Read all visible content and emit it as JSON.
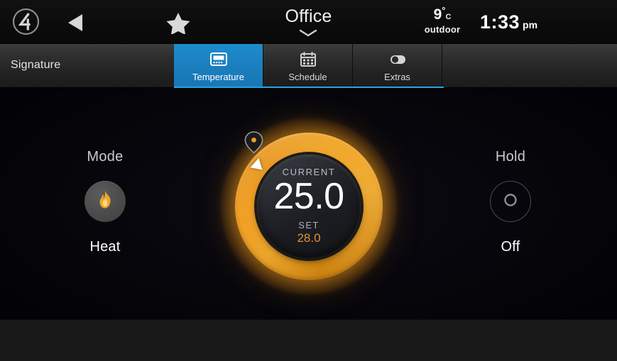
{
  "header": {
    "logo_icon": "control4-logo-icon",
    "back_icon": "back-arrow-icon",
    "favorites_icon": "star-icon",
    "room_name": "Office",
    "room_chevron_icon": "chevron-down-icon",
    "weather": {
      "temperature": "9",
      "degree_symbol": "°",
      "unit": "C",
      "label": "outdoor"
    },
    "clock": {
      "time": "1:33",
      "meridiem": "pm"
    }
  },
  "tabbar": {
    "signature_label": "Signature",
    "active_tab": "Temperature",
    "accent_color": "#1a7ebd",
    "underline_color": "#2aa3e0",
    "tabs": [
      {
        "label": "Temperature",
        "icon": "thermostat-icon",
        "active": true
      },
      {
        "label": "Schedule",
        "icon": "calendar-icon",
        "active": false
      },
      {
        "label": "Extras",
        "icon": "toggle-switch-icon",
        "active": false
      }
    ]
  },
  "thermostat": {
    "current_label": "CURRENT",
    "current_value": "25.0",
    "set_label": "SET",
    "set_value": "28.0",
    "ring_color": "#f0a022",
    "set_value_color": "#e2912f",
    "handle_icon": "dial-handle-icon",
    "pointer_icon": "dial-pointer-icon"
  },
  "mode": {
    "title": "Mode",
    "icon": "flame-icon",
    "state": "Heat"
  },
  "hold": {
    "title": "Hold",
    "icon": "power-circle-icon",
    "state": "Off"
  }
}
